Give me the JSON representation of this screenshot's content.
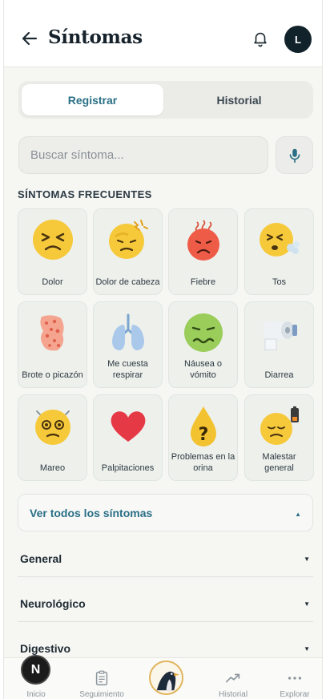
{
  "header": {
    "title": "Síntomas",
    "avatar_initial": "L"
  },
  "tabs": [
    {
      "label": "Registrar",
      "active": true
    },
    {
      "label": "Historial",
      "active": false
    }
  ],
  "search": {
    "placeholder": "Buscar síntoma..."
  },
  "frequent": {
    "title": "SÍNTOMAS FRECUENTES",
    "items": [
      {
        "label": "Dolor",
        "icon": "pained-face-icon"
      },
      {
        "label": "Dolor de cabeza",
        "icon": "headache-face-icon"
      },
      {
        "label": "Fiebre",
        "icon": "hot-face-icon"
      },
      {
        "label": "Tos",
        "icon": "cough-face-icon"
      },
      {
        "label": "Brote o picazón",
        "icon": "rash-icon"
      },
      {
        "label": "Me cuesta respirar",
        "icon": "lungs-icon"
      },
      {
        "label": "Náusea o vómito",
        "icon": "nauseated-face-icon"
      },
      {
        "label": "Diarrea",
        "icon": "toilet-paper-icon"
      },
      {
        "label": "Mareo",
        "icon": "dizzy-face-icon"
      },
      {
        "label": "Palpitaciones",
        "icon": "heart-icon"
      },
      {
        "label": "Problemas en la orina",
        "icon": "drop-question-icon"
      },
      {
        "label": "Malestar general",
        "icon": "low-battery-face-icon"
      }
    ]
  },
  "see_all": {
    "label": "Ver todos los síntomas"
  },
  "categories": [
    {
      "label": "General"
    },
    {
      "label": "Neurológico"
    },
    {
      "label": "Digestivo"
    }
  ],
  "bottom_nav": {
    "badge": "N",
    "items": [
      {
        "label": "Inicio",
        "icon": "home-icon"
      },
      {
        "label": "Seguimiento",
        "icon": "clipboard-icon"
      },
      {
        "label": "",
        "icon": "penguin-logo-icon"
      },
      {
        "label": "Historial",
        "icon": "trend-icon"
      },
      {
        "label": "Explorar",
        "icon": "more-dots-icon"
      }
    ]
  },
  "colors": {
    "accent": "#2a6f86",
    "dark": "#12222b",
    "card_bg": "#eef0ec"
  }
}
